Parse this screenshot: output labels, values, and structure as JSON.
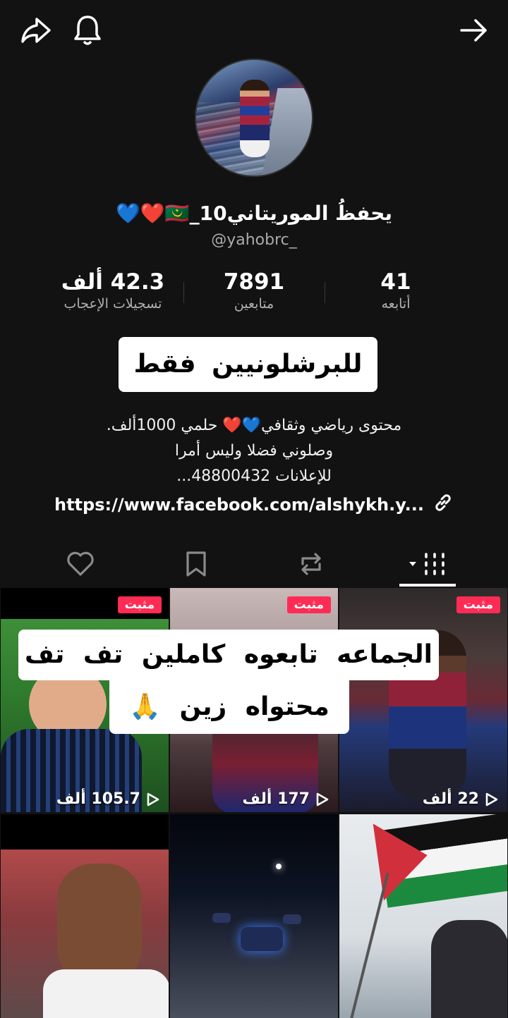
{
  "header": {
    "share_icon": "share-arrow-icon",
    "bell_icon": "bell-icon",
    "forward_icon": "arrow-right-icon"
  },
  "profile": {
    "display_name": "يحفظُ الموريتاني10_🇲🇷❤️💙",
    "username": "@yahobrc_"
  },
  "stats": {
    "following": {
      "value": "41",
      "label": "أتابعه"
    },
    "followers": {
      "value": "7891",
      "label": "متابعين"
    },
    "likes": {
      "value": "42.3 ألف",
      "label": "تسجيلات الإعجاب"
    }
  },
  "banner_text": "للبرشلونيين فقط",
  "bio": {
    "line1": "محتوى رياضي وثقافي💙❤️ حلمي 1000ألف.",
    "line2": "وصلوني فضلا وليس أمرا",
    "line3": "للإعلانات 48800432..."
  },
  "link": {
    "url": "https://www.facebook.com/alshykh.y...",
    "icon": "link-icon"
  },
  "tabs": [
    "videos-grid-icon",
    "repost-icon",
    "bookmark-icon",
    "heart-icon"
  ],
  "videos": [
    {
      "pinned": "مثبت",
      "views": "22 ألف"
    },
    {
      "pinned": "مثبت",
      "views": "177 ألف"
    },
    {
      "pinned": "مثبت",
      "views": "105.7 ألف"
    }
  ],
  "overlay": {
    "line1": "الجماعه تابعوه كاملين تف تف",
    "line2": "محتواه زين 🙏"
  },
  "colors": {
    "background": "#121212",
    "pin_badge": "#fe2c55",
    "muted_text": "#aaaaaa"
  }
}
